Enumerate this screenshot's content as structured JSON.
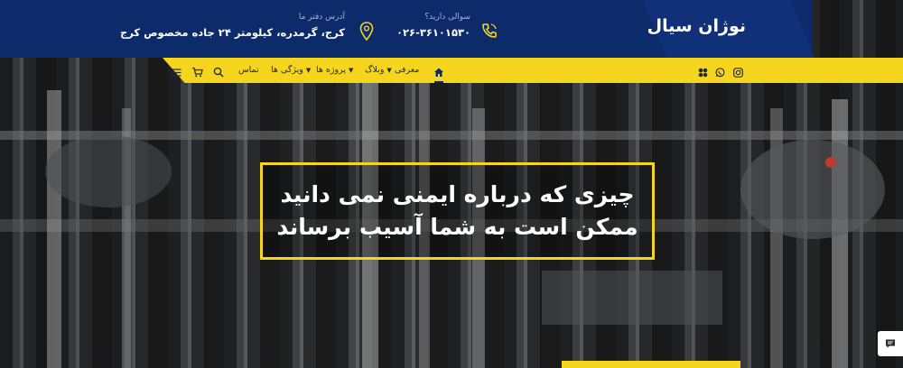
{
  "brand": {
    "name": "نوژان سیال"
  },
  "contact": {
    "phone_label": "سوالی دارید؟",
    "phone_value": "۰۲۶-۳۶۱۰۱۵۳۰",
    "address_label": "آدرس دفتر ما",
    "address_value": "کرج، گرمدره، کیلومتر ۲۴ جاده مخصوص کرج"
  },
  "nav": {
    "items": [
      {
        "label": "معرفی",
        "has_dropdown": false
      },
      {
        "label": "وبلاگ",
        "has_dropdown": true
      },
      {
        "label": "پروژه ها",
        "has_dropdown": true
      },
      {
        "label": "ویژگی ها",
        "has_dropdown": true
      },
      {
        "label": "تماس",
        "has_dropdown": false
      }
    ],
    "icons": [
      "home-icon",
      "search-icon",
      "cart-icon",
      "menu-icon"
    ],
    "social_icons": [
      "instagram-icon",
      "whatsapp-icon",
      "aparat-icon"
    ]
  },
  "hero": {
    "headline_line1": "چیزی که درباره ایمنی نمی دانید",
    "headline_line2": "ممکن است به شما آسیب برساند"
  },
  "colors": {
    "navy": "#0d2b6b",
    "accent_yellow": "#f5d51e"
  }
}
